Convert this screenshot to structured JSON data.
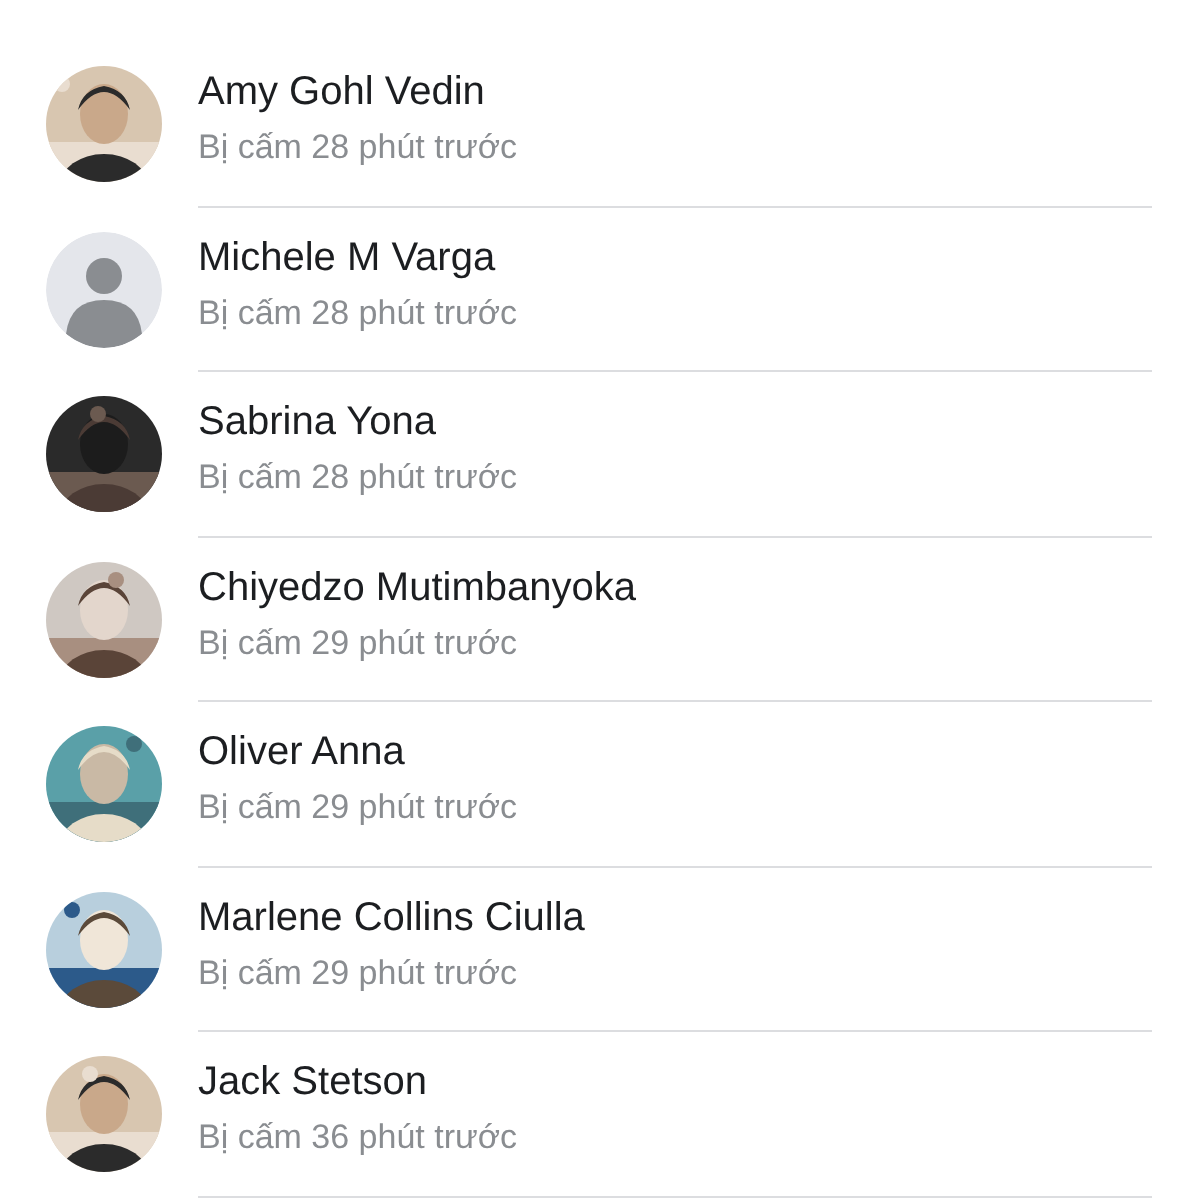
{
  "visitors": [
    {
      "name": "Amy Gohl Vedin",
      "status": "Bị cấm 28 phút trước"
    },
    {
      "name": "Michele M Varga",
      "status": "Bị cấm 28 phút trước",
      "avatar": {
        "kind": "default"
      }
    },
    {
      "name": "Sabrina Yona",
      "status": "Bị cấm 28 phút trước"
    },
    {
      "name": "Chiyedzo Mutimbanyoka",
      "status": "Bị cấm 29 phút trước"
    },
    {
      "name": "Oliver Anna",
      "status": "Bị cấm 29 phút trước"
    },
    {
      "name": "Marlene Collins Ciulla",
      "status": "Bị cấm 29 phút trước"
    },
    {
      "name": "Jack Stetson",
      "status": "Bị cấm 36 phút trước"
    }
  ]
}
